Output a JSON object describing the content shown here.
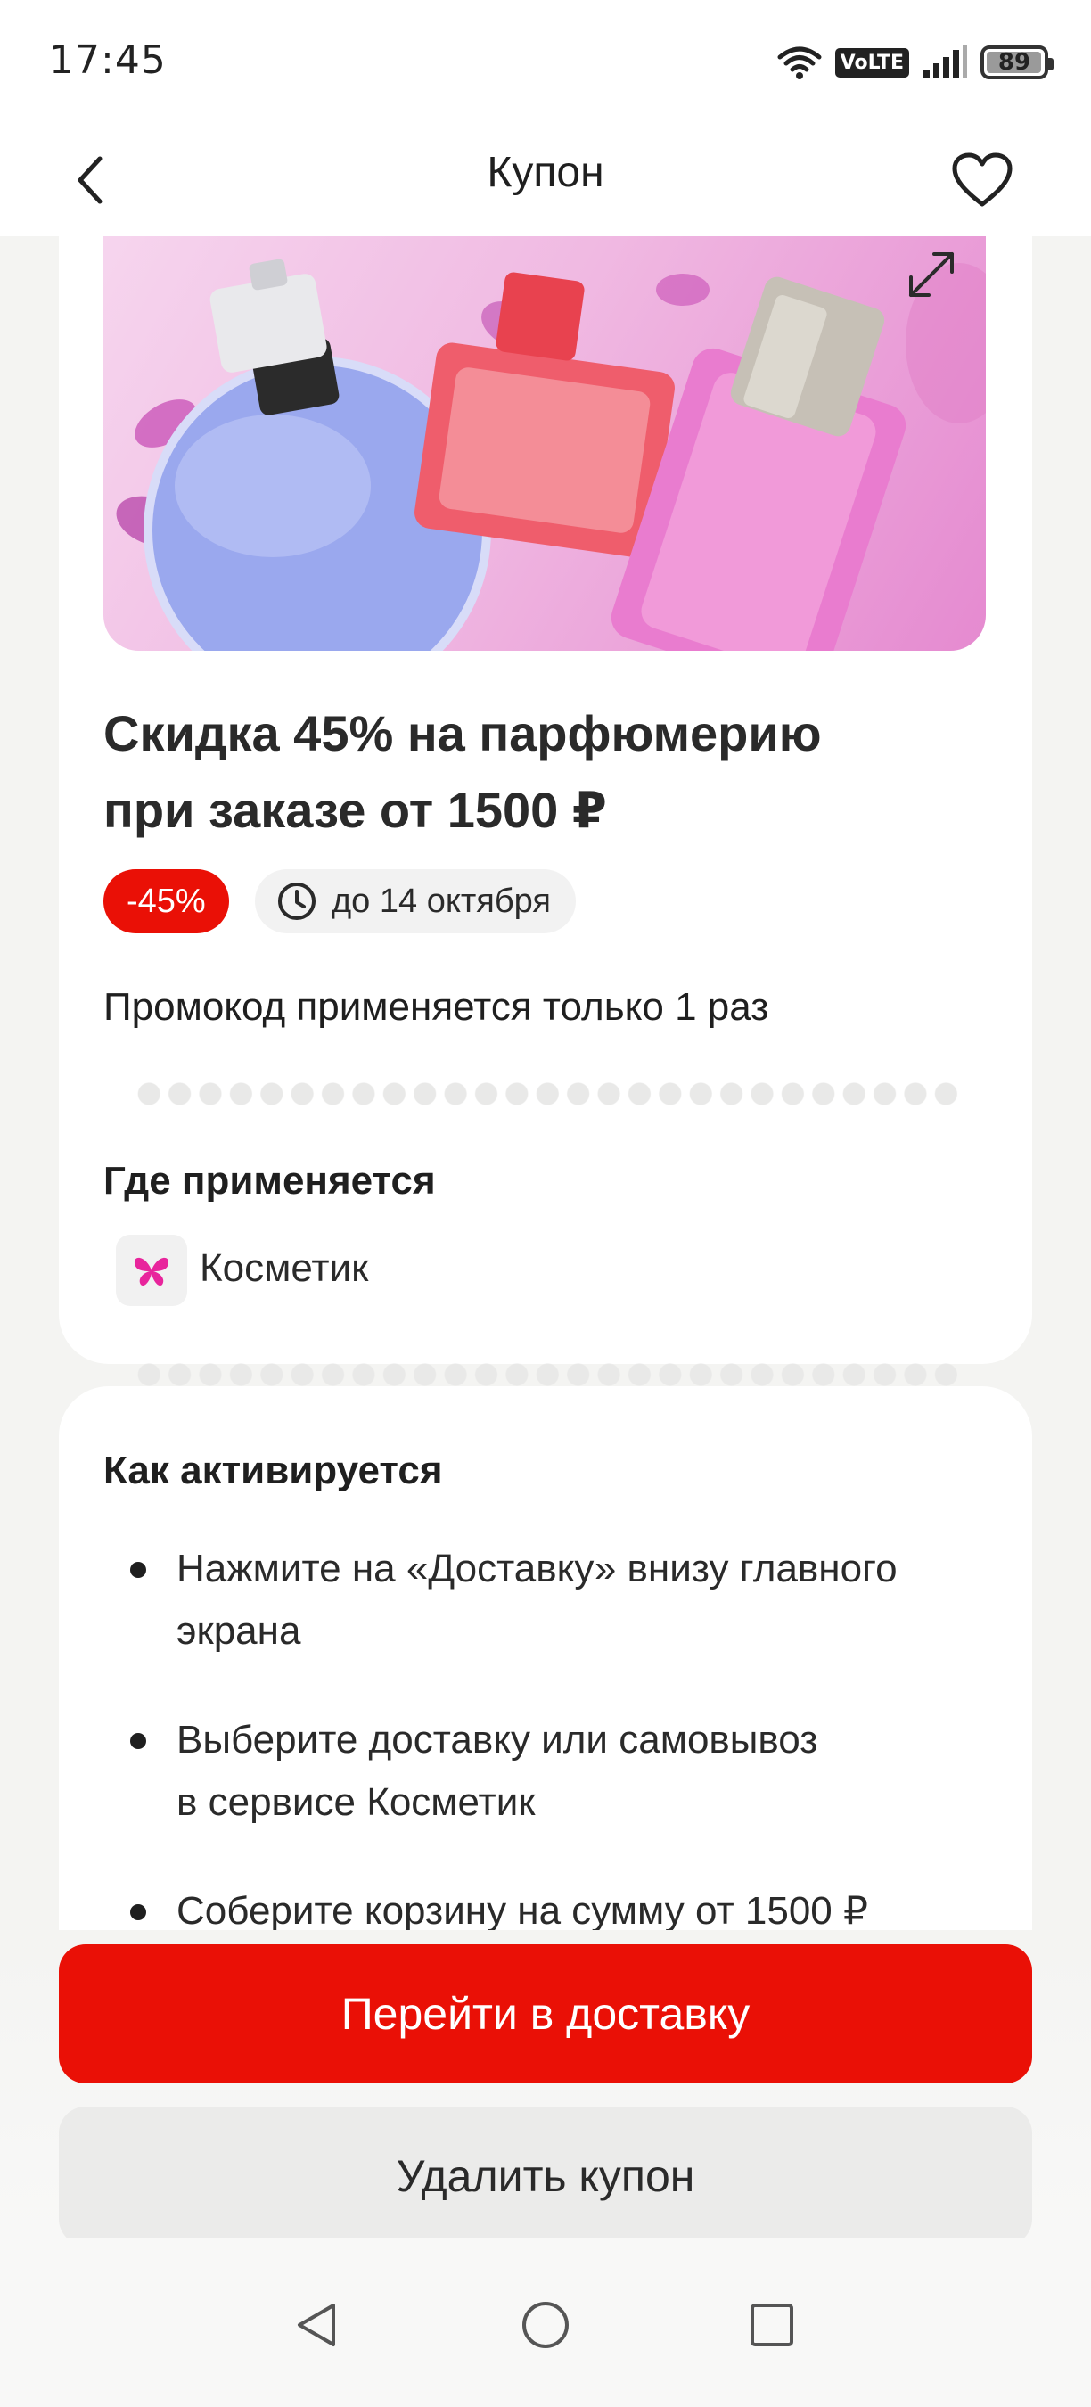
{
  "status_bar": {
    "time": "17:45",
    "network_label": "VoLTE",
    "battery": "89"
  },
  "header": {
    "title": "Купон"
  },
  "coupon": {
    "title_line1": "Скидка 45% на парфюмерию",
    "title_line2": "при заказе от 1500 ₽",
    "discount_badge": "-45%",
    "deadline": "до 14 октября",
    "promo_note": "Промокод применяется только 1 раз"
  },
  "where_applies": {
    "heading": "Где применяется",
    "store_name": "Косметик"
  },
  "how_to_activate": {
    "heading": "Как активируется",
    "steps": [
      {
        "line1": "Нажмите на «Доставку» внизу главного",
        "line2": "экрана"
      },
      {
        "line1": "Выберите доставку или самовывоз",
        "line2": "в сервисе Косметик"
      },
      {
        "line1": "Соберите корзину на сумму от 1500 ₽",
        "line2": ""
      }
    ]
  },
  "actions": {
    "primary_label": "Перейти в доставку",
    "secondary_label": "Удалить купон"
  },
  "colors": {
    "accent": "#ea1006",
    "background": "#f4f4f2",
    "card": "#ffffff",
    "chip": "#f2f2f2",
    "store_logo": "#e8259c"
  },
  "icons": [
    "wifi-icon",
    "signal-icon",
    "battery-icon",
    "back-arrow-icon",
    "heart-icon",
    "expand-icon",
    "clock-icon",
    "butterfly-logo-icon",
    "nav-back-icon",
    "nav-home-icon",
    "nav-recents-icon"
  ]
}
